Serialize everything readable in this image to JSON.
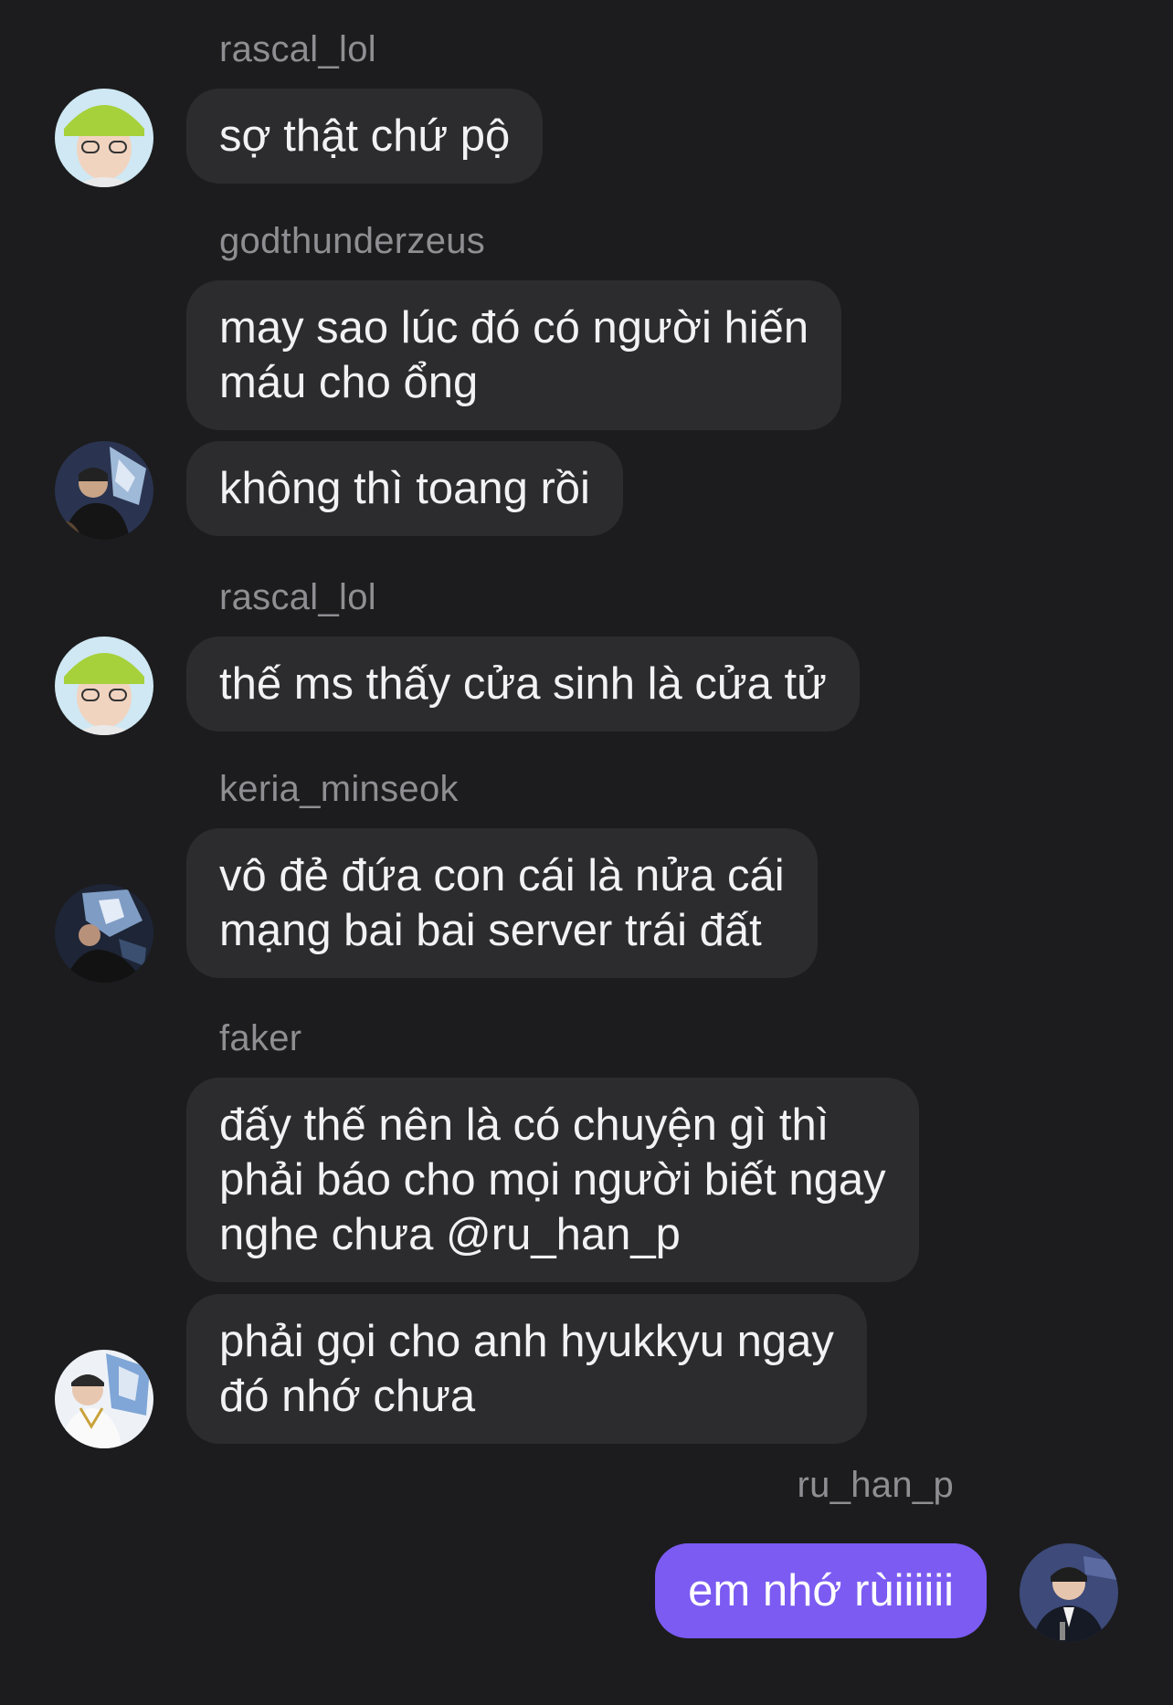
{
  "messages": [
    {
      "sender": "rascal_lol",
      "text": [
        "sợ thật chứ pộ"
      ]
    },
    {
      "sender": "godthunderzeus",
      "text": [
        "may sao lúc đó có người hiến",
        "máu cho ổng"
      ]
    },
    {
      "sender": "godthunderzeus",
      "text": [
        "không thì toang rồi"
      ]
    },
    {
      "sender": "rascal_lol",
      "text": [
        "thế ms thấy cửa sinh là cửa tử"
      ]
    },
    {
      "sender": "keria_minseok",
      "text": [
        "vô đẻ đứa con cái là nửa cái",
        "mạng bai bai server trái đất"
      ]
    },
    {
      "sender": "faker",
      "text": [
        "đấy thế nên là có chuyện gì thì",
        "phải báo cho mọi người biết ngay",
        "nghe chưa @ru_han_p"
      ]
    },
    {
      "sender": "faker",
      "text": [
        "phải gọi cho anh hyukkyu ngay",
        "đó nhớ chưa"
      ]
    },
    {
      "sender": "ru_han_p",
      "text": [
        "em nhớ rùiiiiii"
      ]
    }
  ],
  "colors": {
    "background": "#1c1c1e",
    "bubble_other": "#2c2c2e",
    "bubble_mine": "#7b5bf2",
    "username": "#8e8e93"
  },
  "avatars": {
    "rascal_lol": "avatar-green-hat-person",
    "godthunderzeus": "avatar-trophy-person",
    "keria_minseok": "avatar-trophy-stage",
    "faker": "avatar-smiling-with-trophy",
    "ru_han_p": "avatar-suit-person"
  }
}
